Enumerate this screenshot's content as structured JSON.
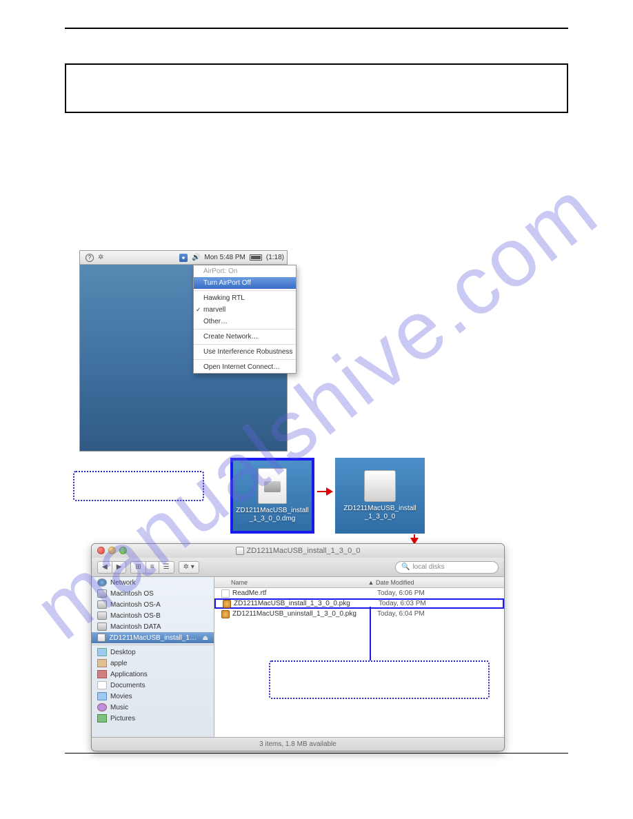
{
  "watermark": "manualshive.com",
  "menubar": {
    "time": "Mon 5:48 PM",
    "battery": "(1:18)"
  },
  "airport_menu": {
    "header": "AirPort: On",
    "turn_off": "Turn AirPort Off",
    "net1": "Hawking RTL",
    "net2": "marvell",
    "other": "Other…",
    "create": "Create Network…",
    "robust": "Use Interference Robustness",
    "open": "Open Internet Connect…"
  },
  "dmg": {
    "label1": "ZD1211MacUSB_install",
    "label2": "_1_3_0_0.dmg"
  },
  "volume": {
    "label1": "ZD1211MacUSB_install",
    "label2": "_1_3_0_0"
  },
  "finder": {
    "title": "ZD1211MacUSB_install_1_3_0_0",
    "search_placeholder": "local disks",
    "col_name": "Name",
    "col_date": "Date Modified",
    "status": "3 items, 1.8 MB available",
    "sidebar": {
      "network": "Network",
      "hd1": "Macintosh OS",
      "hd2": "Macintosh OS-A",
      "hd3": "Macintosh OS-B",
      "hd4": "Macintosh DATA",
      "mounted": "ZD1211MacUSB_install_1_3_0_0",
      "desktop": "Desktop",
      "home": "apple",
      "apps": "Applications",
      "docs": "Documents",
      "movies": "Movies",
      "music": "Music",
      "pics": "Pictures"
    },
    "files": {
      "f1_name": "ReadMe.rtf",
      "f1_date": "Today, 6:06 PM",
      "f2_name": "ZD1211MacUSB_install_1_3_0_0.pkg",
      "f2_date": "Today, 6:03 PM",
      "f3_name": "ZD1211MacUSB_uninstall_1_3_0_0.pkg",
      "f3_date": "Today, 6:04 PM"
    }
  }
}
